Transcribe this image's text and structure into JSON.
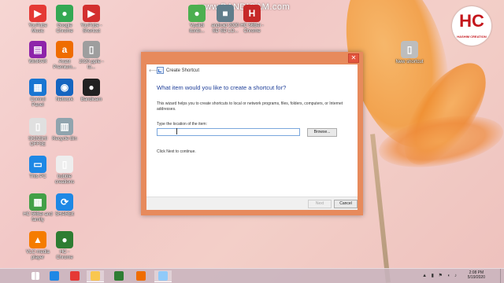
{
  "watermark": "www.BANDICAM.com",
  "logo": {
    "text": "HC",
    "sub": "HASHIM CREATION"
  },
  "desktop_icons": [
    {
      "label": "YouTube\nMusic",
      "color": "#e53935",
      "glyph": "▶"
    },
    {
      "label": "Google\nChrome",
      "color": "#34a853",
      "glyph": "●"
    },
    {
      "label": "YouTube -\nShortcut",
      "color": "#d32f2f",
      "glyph": "▶"
    },
    {
      "label": "Vpalidi\nitunbi...",
      "color": "#4caf50",
      "glyph": "●"
    },
    {
      "label": "android 2020\nSD SD LO...",
      "color": "#607d8b",
      "glyph": "■"
    },
    {
      "label": "HC 56Bei -\nChrome",
      "color": "#c62828",
      "glyph": "H"
    },
    {
      "label": "WinRAR",
      "color": "#8e24aa",
      "glyph": "▤"
    },
    {
      "label": "Avast\nPremium...",
      "color": "#ef6c00",
      "glyph": "a"
    },
    {
      "label": "2020 ppile -\nto...",
      "color": "#9e9e9e",
      "glyph": "▯"
    },
    {
      "label": "New shortcut",
      "color": "#bdbdbd",
      "glyph": "▯"
    },
    {
      "label": "Control\nPanel",
      "color": "#1976d2",
      "glyph": "▦"
    },
    {
      "label": "Network",
      "color": "#1565c0",
      "glyph": "◉"
    },
    {
      "label": "Bandicam",
      "color": "#212121",
      "glyph": "●"
    },
    {
      "label": "SKINSHI\nOFFSE",
      "color": "#e0e0e0",
      "glyph": "▯"
    },
    {
      "label": "Recycle Bin",
      "color": "#90a4ae",
      "glyph": "▥"
    },
    {
      "label": "This PC",
      "color": "#1e88e5",
      "glyph": "▭"
    },
    {
      "label": "bubble\ncreations",
      "color": "#eeeeee",
      "glyph": "▯"
    },
    {
      "label": "HC 56Bei and\nfamily",
      "color": "#43a047",
      "glyph": "▦"
    },
    {
      "label": "SHAREit",
      "color": "#1e88e5",
      "glyph": "⟳"
    },
    {
      "label": "VLC media\nplayer",
      "color": "#f57c00",
      "glyph": "▲"
    },
    {
      "label": "HC -\nChrome",
      "color": "#2e7d32",
      "glyph": "●"
    }
  ],
  "dialog": {
    "title": "Create Shortcut",
    "heading": "What item would you like to create a shortcut for?",
    "description": "This wizard helps you to create shortcuts to local or network programs, files, folders, computers, or Internet addresses.",
    "location_label": "Type the location of the item:",
    "location_value": "",
    "browse_label": "Browse...",
    "click_next": "Click Next to continue.",
    "next_label": "Next",
    "cancel_label": "Cancel",
    "close_glyph": "✕",
    "back_glyph": "⟵"
  },
  "taskbar": {
    "items": [
      {
        "name": "start-button",
        "color": "#ffffff"
      },
      {
        "name": "ie-icon",
        "color": "#1e88e5"
      },
      {
        "name": "chrome-icon",
        "color": "#e53935"
      },
      {
        "name": "file-explorer-icon",
        "color": "#f9c74f"
      },
      {
        "name": "excel-icon",
        "color": "#2e7d32"
      },
      {
        "name": "media-player-icon",
        "color": "#ef6c00"
      },
      {
        "name": "shortcut-window-icon",
        "color": "#90caf9"
      }
    ],
    "time": "2:08 PM",
    "date": "5/19/2020",
    "tray": "▲ ▮ ⚑ ◖ ♪"
  }
}
